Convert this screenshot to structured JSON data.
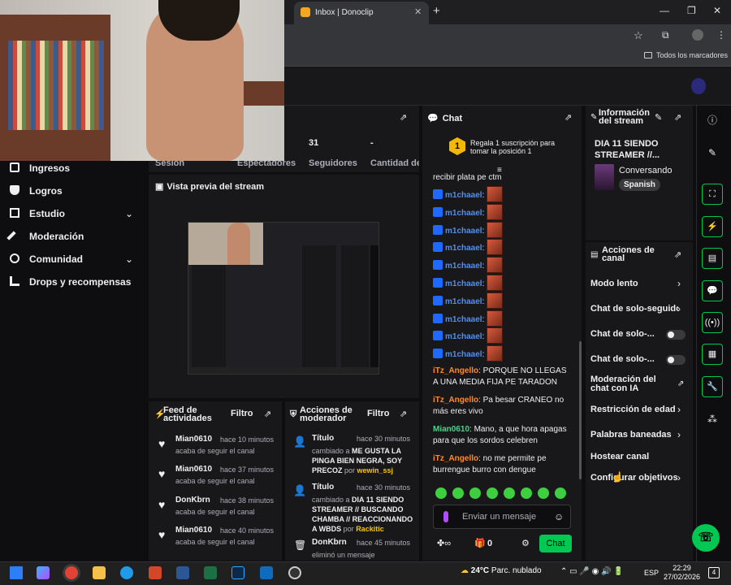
{
  "browser": {
    "tab_title": "Inbox | Donoclip",
    "new_tab": "+",
    "bookmarks_label": "Todos los marcadores"
  },
  "sidebar": {
    "items": [
      {
        "label": "Ingresos",
        "icon": "dollar-icon"
      },
      {
        "label": "Logros",
        "icon": "trophy-icon"
      },
      {
        "label": "Estudio",
        "icon": "studio-icon"
      },
      {
        "label": "Moderación",
        "icon": "wrench-icon"
      },
      {
        "label": "Comunidad",
        "icon": "community-icon"
      },
      {
        "label": "Drops y recompensas",
        "icon": "drops-icon"
      }
    ]
  },
  "stats": {
    "session_label": "Sesión",
    "viewers_label": "Espectadores",
    "followers_value": "31",
    "followers_label": "Seguidores",
    "subs_value": "-",
    "subs_label": "Cantidad de suscripciones"
  },
  "preview": {
    "title": "Vista previa del stream"
  },
  "feed": {
    "title": "Feed de actividades",
    "filter": "Filtro",
    "items": [
      {
        "user": "Mian0610",
        "time": "hace 10 minutos",
        "desc": "acaba de seguir el canal"
      },
      {
        "user": "Mian0610",
        "time": "hace 37 minutos",
        "desc": "acaba de seguir el canal"
      },
      {
        "user": "DonKbrn",
        "time": "hace 38 minutos",
        "desc": "acaba de seguir el canal"
      },
      {
        "user": "Mian0610",
        "time": "hace 40 minutos",
        "desc": "acaba de seguir el canal"
      }
    ]
  },
  "mod": {
    "title": "Acciones de moderador",
    "filter": "Filtro",
    "items": [
      {
        "title": "Título",
        "time": "hace 30 minutos",
        "pre": "cambiado a ",
        "value": "ME GUSTA LA PINGA BIEN NEGRA, SOY PRECOZ",
        "by_label": " por ",
        "by": "wewin_ssj"
      },
      {
        "title": "Título",
        "time": "hace 30 minutos",
        "pre": "cambiado a ",
        "value": "DIA 11 SIENDO STREAMER // BUSCANDO CHAMBA // REACCIONANDO A WBDS",
        "by_label": " por ",
        "by": "Rackitic"
      },
      {
        "title": "DonKbrn",
        "time": "hace 45 minutos",
        "pre": "eliminó un mensaje",
        "value": "",
        "by_label": "",
        "by": ""
      }
    ]
  },
  "chat": {
    "title": "Chat",
    "gift_text": "Regala 1 suscripción para tomar la posición 1",
    "gift_rank": "1",
    "partial_line": "recibir plata pe ctm",
    "emote_user": "m1chaael",
    "emote_count": 10,
    "messages": [
      {
        "user": "iTz_Angello",
        "color": "orange",
        "text": ": PORQUE NO LLEGAS A UNA MEDIA FIJA PE TARADON"
      },
      {
        "user": "iTz_Angello",
        "color": "orange",
        "text": ": Pa besar CRANEO no más eres vivo"
      },
      {
        "user": "Mian0610",
        "color": "green",
        "text": ": Mano, a que hora apagas para que los sordos celebren"
      },
      {
        "user": "iTz_Angello",
        "color": "orange",
        "text": ": no me permite pe burrengue burro con dengue"
      }
    ],
    "input_placeholder": "Enviar un mensaje",
    "points": "0",
    "send_label": "Chat"
  },
  "stream_info": {
    "title": "Información del stream",
    "stream_title": "DIA 11 SIENDO STREAMER //...",
    "category": "Conversando",
    "language": "Spanish"
  },
  "channel_actions": {
    "title": "Acciones de canal",
    "items": [
      {
        "label": "Modo lento",
        "control": "chevron"
      },
      {
        "label": "Chat de solo-seguidores",
        "control": "chevron"
      },
      {
        "label": "Chat de solo-...",
        "control": "toggle"
      },
      {
        "label": "Chat de solo-...",
        "control": "toggle"
      },
      {
        "label": "Moderación del chat con IA",
        "control": "external"
      },
      {
        "label": "Restricción de edad",
        "control": "chevron"
      },
      {
        "label": "Palabras baneadas",
        "control": "chevron"
      },
      {
        "label": "Hostear canal",
        "control": "none"
      },
      {
        "label": "Configurar objetivos",
        "control": "chevron"
      }
    ]
  },
  "taskbar": {
    "temperature": "24°C",
    "weather": "Parc. nublado",
    "lang": "ESP",
    "time": "22:29",
    "date": "27/02/2026",
    "notifications": "4"
  },
  "colors": {
    "accent": "#00c853",
    "bg": "#0e0e10",
    "panel": "#18181b"
  }
}
